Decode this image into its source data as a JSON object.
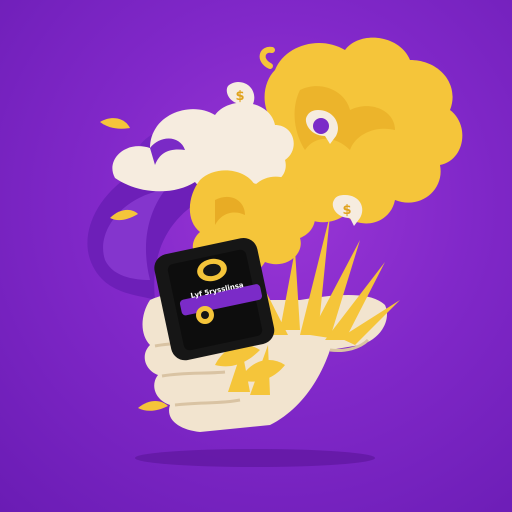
{
  "illustration": {
    "phone_label": "Lyf 5rysslinsa",
    "colors": {
      "background": "#8128c9",
      "background_dark": "#6a1cb4",
      "gold": "#f5c53a",
      "gold_dark": "#e0a21c",
      "cloud": "#f6ecdf",
      "hand": "#f2e4cf",
      "phone": "#161616",
      "accent_purple": "#7b2bc8"
    },
    "icons": [
      "coin-bubble-icon",
      "coin-bubble-icon",
      "purple-coin-bubble-icon",
      "phone-icon",
      "hand-icon",
      "cloud-icon",
      "plant-icon"
    ]
  }
}
